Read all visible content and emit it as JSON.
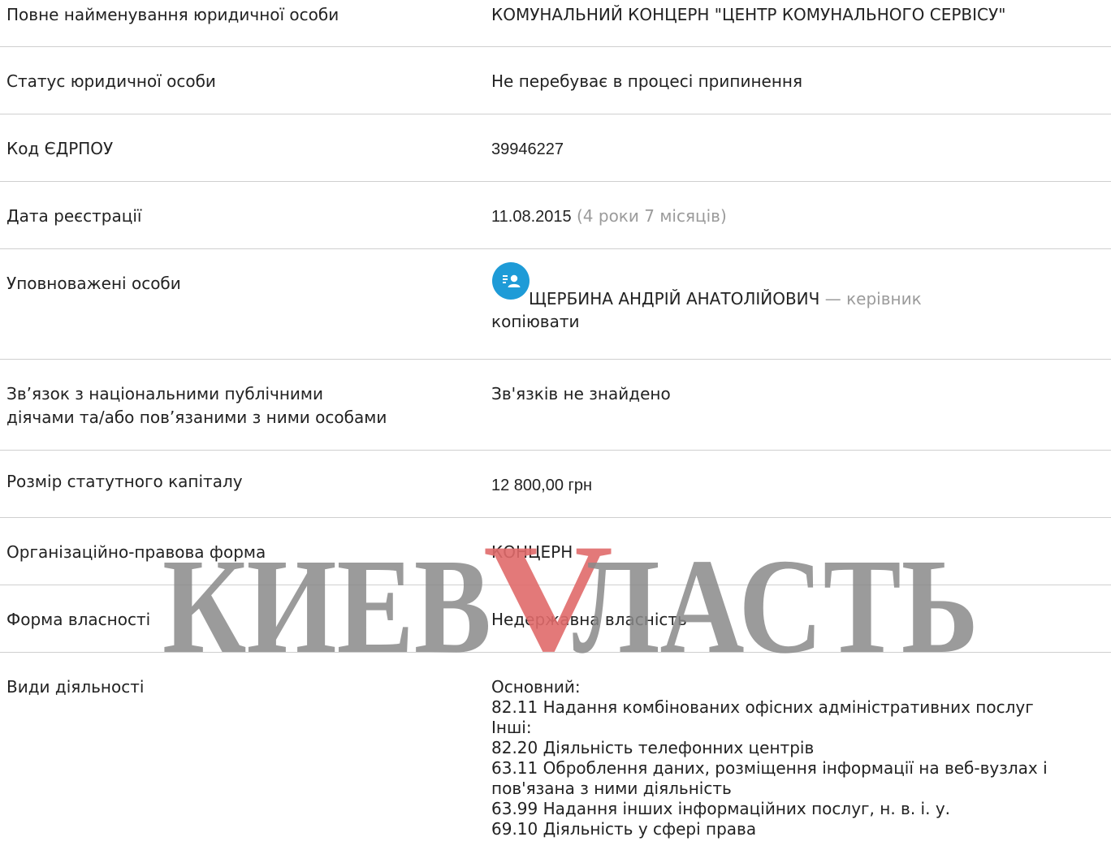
{
  "rows": {
    "full_name": {
      "label": "Повне найменування юридичної особи",
      "value": "КОМУНАЛЬНИЙ КОНЦЕРН \"ЦЕНТР КОМУНАЛЬНОГО СЕРВІСУ\""
    },
    "status": {
      "label": "Статус юридичної особи",
      "value": "Не перебуває в процесі припинення"
    },
    "edrpou": {
      "label": "Код ЄДРПОУ",
      "value": "39946227"
    },
    "reg_date": {
      "label": "Дата реєстрації",
      "value": "11.08.2015",
      "age": "(4 роки 7 місяців)"
    },
    "persons": {
      "label": "Уповноважені особи",
      "name": "ЩЕРБИНА АНДРІЙ АНАТОЛІЙОВИЧ",
      "role": "— керівник",
      "copy": "копіювати"
    },
    "pep": {
      "label_line1": "Зв’язок з національними публічними",
      "label_line2": "діячами та/або пов’язаними з ними особами",
      "value": "Зв'язків не знайдено"
    },
    "capital": {
      "label": "Розмір статутного капіталу",
      "value": "12 800,00 грн"
    },
    "legal_form": {
      "label": "Організаційно-правова форма",
      "value": "КОНЦЕРН"
    },
    "ownership": {
      "label": "Форма власності",
      "value": "Недержавна власність"
    },
    "activities": {
      "label": "Види діяльності",
      "main_title": "Основний:",
      "main": "82.11 Надання комбінованих офісних адміністративних послуг",
      "other_title": "Інші:",
      "other": [
        "82.20 Діяльність телефонних центрів",
        "63.11 Оброблення даних, розміщення інформації на веб-вузлах і",
        "пов'язана з ними діяльність",
        "63.99 Надання інших інформаційних послуг, н. в. і. у.",
        "69.10 Діяльність у сфері права"
      ]
    }
  },
  "watermark": {
    "text_left": "КИЕВ",
    "v": "V",
    "text_right": "ЛАСТЬ"
  },
  "colors": {
    "avatar": "#1e9bd7",
    "muted": "#9b9b9b",
    "divider": "#cfcfcf",
    "watermark_gray": "#8a8a8a",
    "watermark_red": "#e06a6a"
  },
  "icons": {
    "avatar": "person-card-icon"
  }
}
